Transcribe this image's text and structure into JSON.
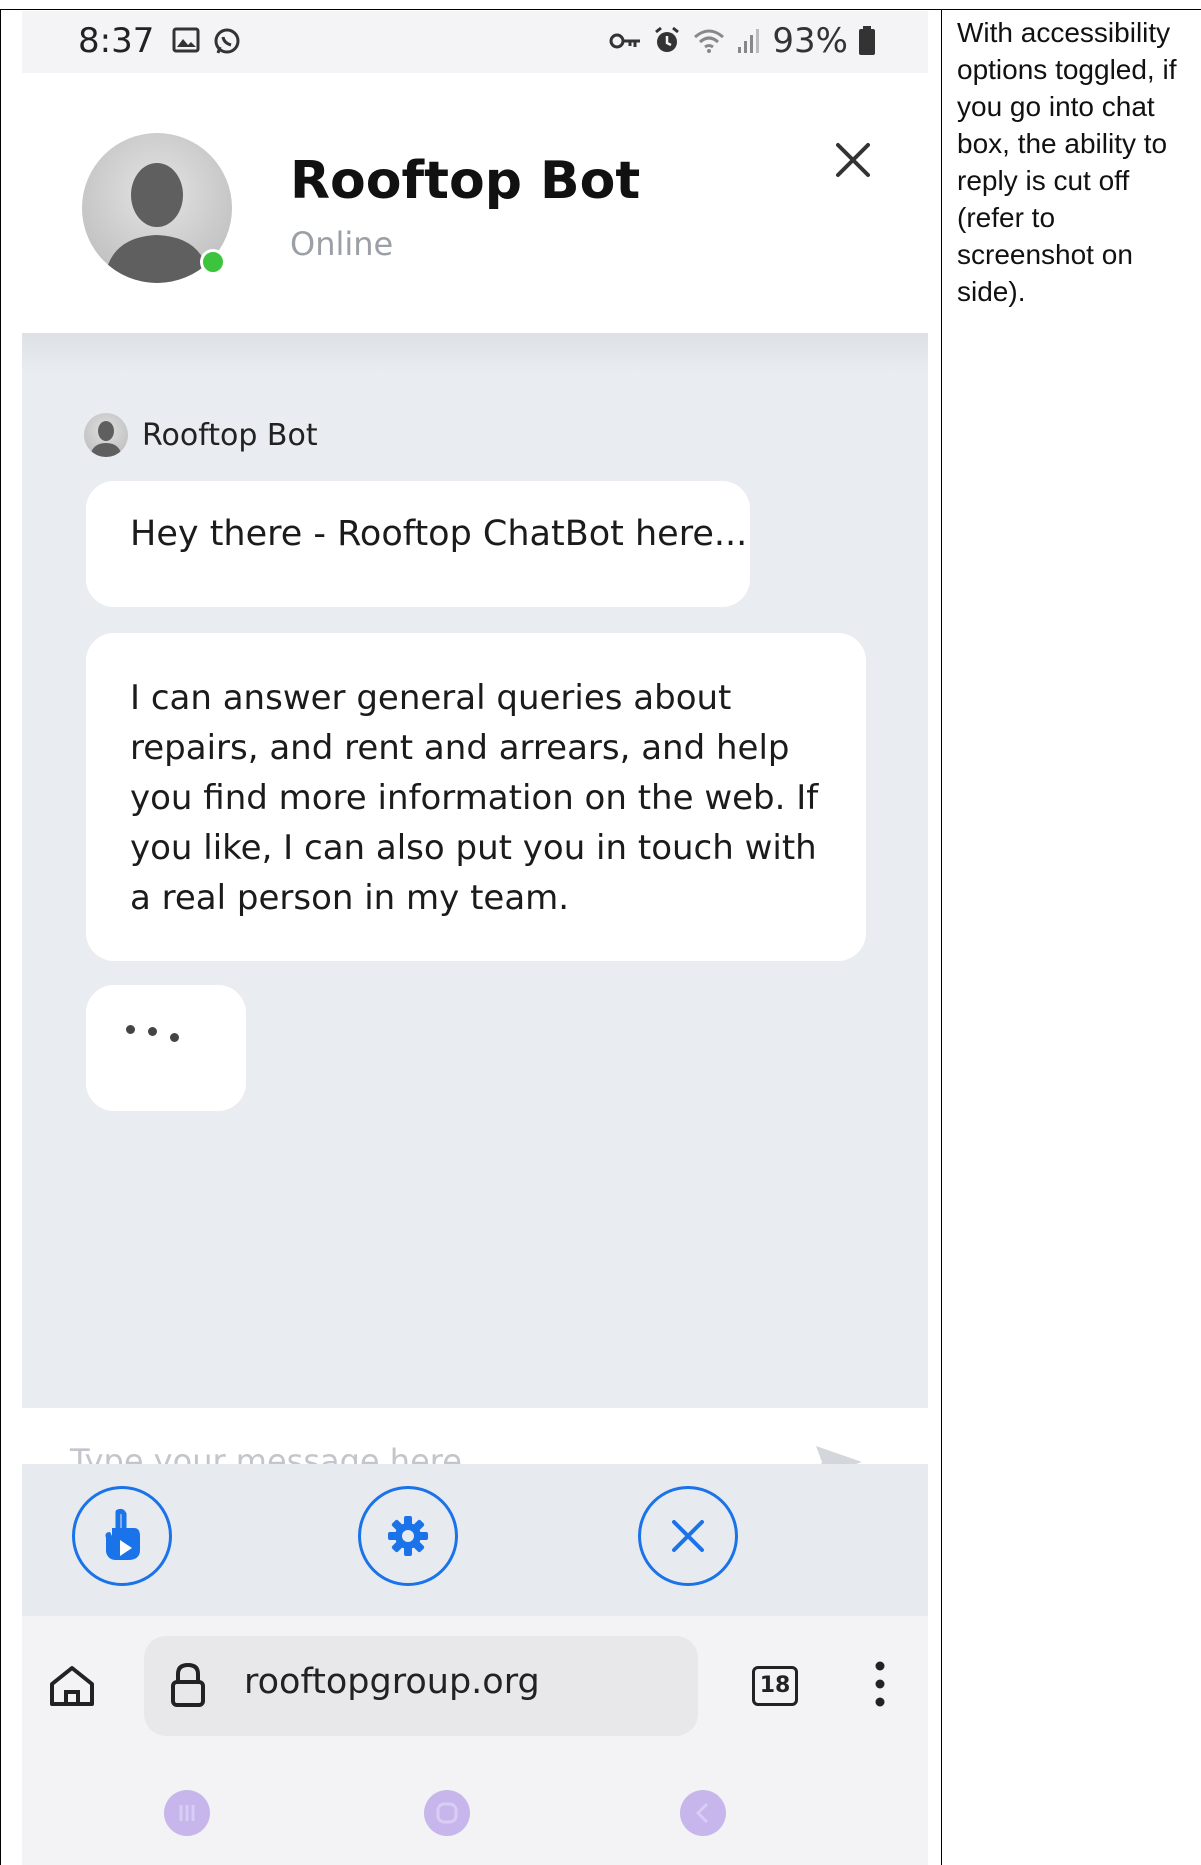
{
  "status_bar": {
    "time": "8:37",
    "battery": "93%"
  },
  "chat_header": {
    "bot_name": "Rooftop Bot",
    "status": "Online"
  },
  "chat": {
    "sender_name": "Rooftop Bot",
    "messages": [
      "Hey there - Rooftop ChatBot here...",
      "I can answer general queries about repairs, and rent and arrears, and help you find more information on the web. If you like, I can also put you in touch with a real person in my team."
    ]
  },
  "input": {
    "placeholder": "Type your message here"
  },
  "browser": {
    "url": "rooftopgroup.org",
    "tab_count": "18"
  },
  "note": {
    "text": "With accessibility options toggled, if you go into chat box, the ability to reply is cut off (refer to screenshot on side)."
  },
  "colors": {
    "accent_blue": "#1a73e8",
    "chat_background": "#e9ecf0",
    "online_green": "#3cc43c"
  }
}
